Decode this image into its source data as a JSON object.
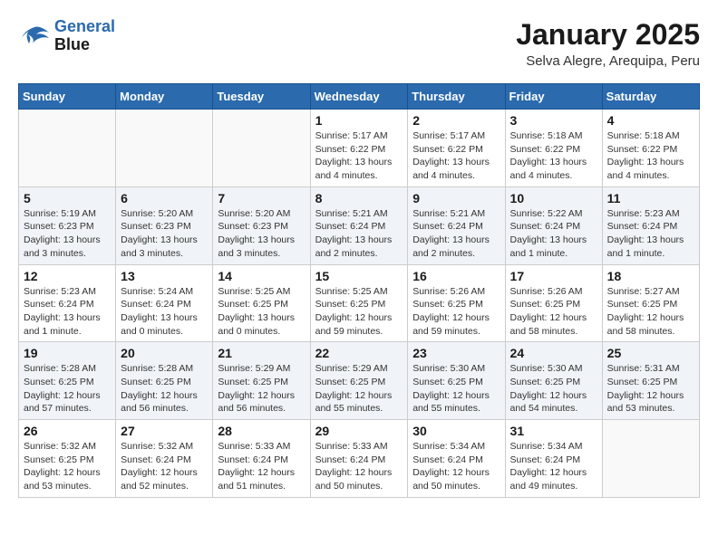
{
  "header": {
    "logo_line1": "General",
    "logo_line2": "Blue",
    "month": "January 2025",
    "location": "Selva Alegre, Arequipa, Peru"
  },
  "days_of_week": [
    "Sunday",
    "Monday",
    "Tuesday",
    "Wednesday",
    "Thursday",
    "Friday",
    "Saturday"
  ],
  "weeks": [
    [
      {
        "day": "",
        "info": ""
      },
      {
        "day": "",
        "info": ""
      },
      {
        "day": "",
        "info": ""
      },
      {
        "day": "1",
        "info": "Sunrise: 5:17 AM\nSunset: 6:22 PM\nDaylight: 13 hours\nand 4 minutes."
      },
      {
        "day": "2",
        "info": "Sunrise: 5:17 AM\nSunset: 6:22 PM\nDaylight: 13 hours\nand 4 minutes."
      },
      {
        "day": "3",
        "info": "Sunrise: 5:18 AM\nSunset: 6:22 PM\nDaylight: 13 hours\nand 4 minutes."
      },
      {
        "day": "4",
        "info": "Sunrise: 5:18 AM\nSunset: 6:22 PM\nDaylight: 13 hours\nand 4 minutes."
      }
    ],
    [
      {
        "day": "5",
        "info": "Sunrise: 5:19 AM\nSunset: 6:23 PM\nDaylight: 13 hours\nand 3 minutes."
      },
      {
        "day": "6",
        "info": "Sunrise: 5:20 AM\nSunset: 6:23 PM\nDaylight: 13 hours\nand 3 minutes."
      },
      {
        "day": "7",
        "info": "Sunrise: 5:20 AM\nSunset: 6:23 PM\nDaylight: 13 hours\nand 3 minutes."
      },
      {
        "day": "8",
        "info": "Sunrise: 5:21 AM\nSunset: 6:24 PM\nDaylight: 13 hours\nand 2 minutes."
      },
      {
        "day": "9",
        "info": "Sunrise: 5:21 AM\nSunset: 6:24 PM\nDaylight: 13 hours\nand 2 minutes."
      },
      {
        "day": "10",
        "info": "Sunrise: 5:22 AM\nSunset: 6:24 PM\nDaylight: 13 hours\nand 1 minute."
      },
      {
        "day": "11",
        "info": "Sunrise: 5:23 AM\nSunset: 6:24 PM\nDaylight: 13 hours\nand 1 minute."
      }
    ],
    [
      {
        "day": "12",
        "info": "Sunrise: 5:23 AM\nSunset: 6:24 PM\nDaylight: 13 hours\nand 1 minute."
      },
      {
        "day": "13",
        "info": "Sunrise: 5:24 AM\nSunset: 6:24 PM\nDaylight: 13 hours\nand 0 minutes."
      },
      {
        "day": "14",
        "info": "Sunrise: 5:25 AM\nSunset: 6:25 PM\nDaylight: 13 hours\nand 0 minutes."
      },
      {
        "day": "15",
        "info": "Sunrise: 5:25 AM\nSunset: 6:25 PM\nDaylight: 12 hours\nand 59 minutes."
      },
      {
        "day": "16",
        "info": "Sunrise: 5:26 AM\nSunset: 6:25 PM\nDaylight: 12 hours\nand 59 minutes."
      },
      {
        "day": "17",
        "info": "Sunrise: 5:26 AM\nSunset: 6:25 PM\nDaylight: 12 hours\nand 58 minutes."
      },
      {
        "day": "18",
        "info": "Sunrise: 5:27 AM\nSunset: 6:25 PM\nDaylight: 12 hours\nand 58 minutes."
      }
    ],
    [
      {
        "day": "19",
        "info": "Sunrise: 5:28 AM\nSunset: 6:25 PM\nDaylight: 12 hours\nand 57 minutes."
      },
      {
        "day": "20",
        "info": "Sunrise: 5:28 AM\nSunset: 6:25 PM\nDaylight: 12 hours\nand 56 minutes."
      },
      {
        "day": "21",
        "info": "Sunrise: 5:29 AM\nSunset: 6:25 PM\nDaylight: 12 hours\nand 56 minutes."
      },
      {
        "day": "22",
        "info": "Sunrise: 5:29 AM\nSunset: 6:25 PM\nDaylight: 12 hours\nand 55 minutes."
      },
      {
        "day": "23",
        "info": "Sunrise: 5:30 AM\nSunset: 6:25 PM\nDaylight: 12 hours\nand 55 minutes."
      },
      {
        "day": "24",
        "info": "Sunrise: 5:30 AM\nSunset: 6:25 PM\nDaylight: 12 hours\nand 54 minutes."
      },
      {
        "day": "25",
        "info": "Sunrise: 5:31 AM\nSunset: 6:25 PM\nDaylight: 12 hours\nand 53 minutes."
      }
    ],
    [
      {
        "day": "26",
        "info": "Sunrise: 5:32 AM\nSunset: 6:25 PM\nDaylight: 12 hours\nand 53 minutes."
      },
      {
        "day": "27",
        "info": "Sunrise: 5:32 AM\nSunset: 6:24 PM\nDaylight: 12 hours\nand 52 minutes."
      },
      {
        "day": "28",
        "info": "Sunrise: 5:33 AM\nSunset: 6:24 PM\nDaylight: 12 hours\nand 51 minutes."
      },
      {
        "day": "29",
        "info": "Sunrise: 5:33 AM\nSunset: 6:24 PM\nDaylight: 12 hours\nand 50 minutes."
      },
      {
        "day": "30",
        "info": "Sunrise: 5:34 AM\nSunset: 6:24 PM\nDaylight: 12 hours\nand 50 minutes."
      },
      {
        "day": "31",
        "info": "Sunrise: 5:34 AM\nSunset: 6:24 PM\nDaylight: 12 hours\nand 49 minutes."
      },
      {
        "day": "",
        "info": ""
      }
    ]
  ]
}
